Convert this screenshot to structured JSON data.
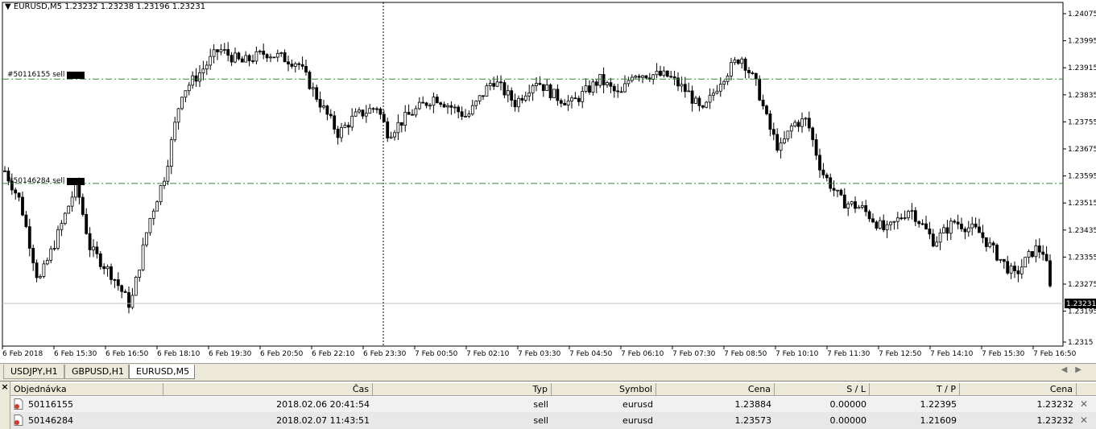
{
  "chart": {
    "title": "EURUSD,M5  1.23232 1.23238 1.23196 1.23231",
    "current_price": "1.23231",
    "price_axis": [
      "1.24075",
      "1.23995",
      "1.23915",
      "1.23835",
      "1.23755",
      "1.23675",
      "1.23595",
      "1.23515",
      "1.23435",
      "1.23355",
      "1.23275",
      "1.23195",
      "1.2315"
    ],
    "time_axis": [
      "6 Feb 2018",
      "6 Feb 15:30",
      "6 Feb 16:50",
      "6 Feb 18:10",
      "6 Feb 19:30",
      "6 Feb 20:50",
      "6 Feb 22:10",
      "6 Feb 23:30",
      "7 Feb 00:50",
      "7 Feb 02:10",
      "7 Feb 03:30",
      "7 Feb 04:50",
      "7 Feb 06:10",
      "7 Feb 07:30",
      "7 Feb 08:50",
      "7 Feb 10:10",
      "7 Feb 11:30",
      "7 Feb 12:50",
      "7 Feb 14:10",
      "7 Feb 15:30",
      "7 Feb 16:50"
    ],
    "order_lines": [
      {
        "label": "#50116155 sell",
        "price": 1.23884
      },
      {
        "label": "#50146284 sell",
        "price": 1.23573
      }
    ],
    "colors": {
      "candle": "#000000",
      "order_line": "#2e8b2e",
      "bid_line": "#c0c0c0"
    }
  },
  "tabs": [
    {
      "label": "USDJPY,H1"
    },
    {
      "label": "GBPUSD,H1"
    },
    {
      "label": "EURUSD,M5"
    }
  ],
  "terminal": {
    "close_glyph": "×",
    "headers": [
      "Objednávka",
      "Čas",
      "Typ",
      "Symbol",
      "Cena",
      "S / L",
      "T / P",
      "Cena"
    ],
    "rows": [
      {
        "order": "50116155",
        "time": "2018.02.06 20:41:54",
        "type": "sell",
        "symbol": "eurusd",
        "price": "1.23884",
        "sl": "0.00000",
        "tp": "1.22395",
        "cur": "1.23232"
      },
      {
        "order": "50146284",
        "time": "2018.02.07 11:43:51",
        "type": "sell",
        "symbol": "eurusd",
        "price": "1.23573",
        "sl": "0.00000",
        "tp": "1.21609",
        "cur": "1.23232"
      }
    ]
  }
}
